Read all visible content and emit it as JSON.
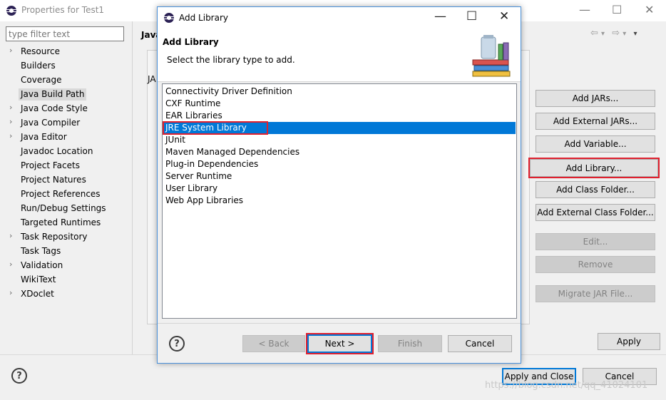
{
  "outer_window": {
    "title": "Properties for Test1",
    "controls": {
      "minimize": "—",
      "maximize": "☐",
      "close": "✕"
    }
  },
  "filter": {
    "placeholder": "type filter text"
  },
  "tree": {
    "items": [
      {
        "label": "Resource",
        "expandable": true
      },
      {
        "label": "Builders",
        "expandable": false
      },
      {
        "label": "Coverage",
        "expandable": false
      },
      {
        "label": "Java Build Path",
        "expandable": false,
        "selected": true
      },
      {
        "label": "Java Code Style",
        "expandable": true
      },
      {
        "label": "Java Compiler",
        "expandable": true
      },
      {
        "label": "Java Editor",
        "expandable": true
      },
      {
        "label": "Javadoc Location",
        "expandable": false
      },
      {
        "label": "Project Facets",
        "expandable": false
      },
      {
        "label": "Project Natures",
        "expandable": false
      },
      {
        "label": "Project References",
        "expandable": false
      },
      {
        "label": "Run/Debug Settings",
        "expandable": false
      },
      {
        "label": "Targeted Runtimes",
        "expandable": false
      },
      {
        "label": "Task Repository",
        "expandable": true
      },
      {
        "label": "Task Tags",
        "expandable": false
      },
      {
        "label": "Validation",
        "expandable": true
      },
      {
        "label": "WikiText",
        "expandable": false
      },
      {
        "label": "XDoclet",
        "expandable": true
      }
    ]
  },
  "page": {
    "title": "Java",
    "jar_label": "JA",
    "nav": {
      "back": "⇦",
      "back_menu": "▾",
      "forward": "⇨",
      "forward_menu": "▾",
      "menu": "▾"
    }
  },
  "side_buttons": {
    "add_jars": "Add JARs...",
    "add_external_jars": "Add External JARs...",
    "add_variable": "Add Variable...",
    "add_library": "Add Library...",
    "add_class_folder": "Add Class Folder...",
    "add_external_class_folder": "Add External Class Folder...",
    "edit": "Edit...",
    "remove": "Remove",
    "migrate_jar": "Migrate JAR File..."
  },
  "outer_buttons": {
    "apply": "Apply",
    "apply_and_close": "Apply and Close",
    "cancel": "Cancel"
  },
  "dialog": {
    "title": "Add Library",
    "controls": {
      "minimize": "—",
      "maximize": "☐",
      "close": "✕"
    },
    "heading": "Add Library",
    "description": "Select the library type to add.",
    "libraries": [
      "Connectivity Driver Definition",
      "CXF Runtime",
      "EAR Libraries",
      "JRE System Library",
      "JUnit",
      "Maven Managed Dependencies",
      "Plug-in Dependencies",
      "Server Runtime",
      "User Library",
      "Web App Libraries"
    ],
    "selected_index": 3,
    "buttons": {
      "back": "< Back",
      "next": "Next >",
      "finish": "Finish",
      "cancel": "Cancel"
    },
    "help": "?"
  },
  "help": "?",
  "watermark": "https://blog.csdn.net/qq_41024101",
  "colors": {
    "selection": "#0078d7",
    "highlight_outline": "#e0202e",
    "dialog_border": "#4a90d9"
  }
}
